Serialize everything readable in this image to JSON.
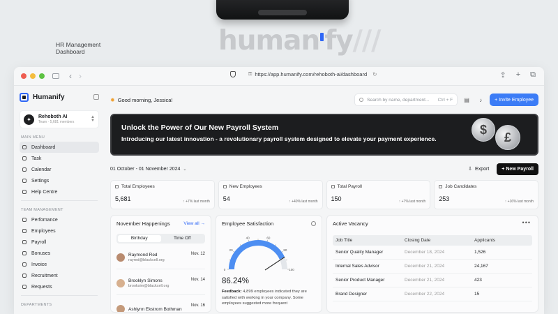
{
  "backdrop": {
    "caption": "HR Management Dashboard",
    "wordmark_left": "human",
    "wordmark_right": "fy",
    "wordmark_tail": "///"
  },
  "browser": {
    "url": "https://app.humanify.com/rehoboth-ai/dashboard",
    "back_glyph": "‹",
    "forward_glyph": "›"
  },
  "sidebar": {
    "brand": "Humanify",
    "org": {
      "name": "Rehoboth AI",
      "sub": "Team · 5,681 members",
      "initial": "✦"
    },
    "main_menu_label": "MAIN MENU",
    "main_items": [
      {
        "label": "Dashboard",
        "icon": "grid-icon",
        "active": true
      },
      {
        "label": "Task",
        "icon": "list-icon"
      },
      {
        "label": "Calendar",
        "icon": "calendar-icon"
      },
      {
        "label": "Settings",
        "icon": "gear-icon"
      },
      {
        "label": "Help Centre",
        "icon": "help-icon"
      }
    ],
    "team_label": "TEAM MANAGEMENT",
    "team_items": [
      {
        "label": "Perfomance",
        "icon": "chart-icon"
      },
      {
        "label": "Employees",
        "icon": "users-icon"
      },
      {
        "label": "Payroll",
        "icon": "wallet-icon"
      },
      {
        "label": "Bonuses",
        "icon": "gift-icon"
      },
      {
        "label": "Invoice",
        "icon": "file-icon"
      },
      {
        "label": "Recruitment",
        "icon": "briefcase-icon"
      },
      {
        "label": "Requests",
        "icon": "inbox-icon"
      }
    ],
    "dept_label": "DEPARTMENTS"
  },
  "header": {
    "greeting": "Good morning, Jessica!",
    "search_placeholder": "Search by name, department...",
    "search_shortcut": "Ctrl + F",
    "invite_label": "+ Invite Employee"
  },
  "banner": {
    "title": "Unlock the Power of Our New Payroll System",
    "subtitle": "Introducing our latest innovation - a revolutionary payroll system designed to elevate your payment experience.",
    "coin1": "$",
    "coin2": "£"
  },
  "filters": {
    "date_range": "01 October - 01 November 2024",
    "export_label": "Export",
    "new_payroll_label": "+ New Payroll"
  },
  "stats": [
    {
      "label": "Total Employees",
      "value": "5,681",
      "change": "↑ +7% last month"
    },
    {
      "label": "New Employees",
      "value": "54",
      "change": "↑ +40% last month"
    },
    {
      "label": "Total Payroll",
      "value": "150",
      "change": "↑ +7% last month"
    },
    {
      "label": "Job Candidates",
      "value": "253",
      "change": "↑ +16% last month"
    }
  ],
  "happenings": {
    "title": "November Happenings",
    "view_all": "View all →",
    "tabs": [
      "Birthday",
      "Time Off"
    ],
    "people": [
      {
        "name": "Raymond Red",
        "email": "rayred@blackcell.org",
        "date": "Nov. 12"
      },
      {
        "name": "Brooklyn Simons",
        "email": "brooksim@blackcell.org",
        "date": "Nov. 14"
      },
      {
        "name": "Ashlynn Ekstrom Bothman",
        "email": "",
        "date": "Nov. 16"
      }
    ]
  },
  "satisfaction": {
    "title": "Employee Satisfaction",
    "value_pct": 86.24,
    "value_label": "86.24%",
    "gauge_ticks": [
      "0",
      "10",
      "20",
      "30",
      "40",
      "50",
      "60",
      "70",
      "80",
      "90",
      "100"
    ],
    "feedback_lead": "Feedback:",
    "feedback": " 4,899 employees indicated they are satisfied with working in your company. Some employees suggested more frequent"
  },
  "vacancy": {
    "title": "Active Vacancy",
    "more": "•••",
    "columns": [
      "Job Title",
      "Closing Date",
      "Applicants"
    ],
    "rows": [
      [
        "Senior Quality Manager",
        "December 18, 2024",
        "1,526"
      ],
      [
        "Internal Sales Advisor",
        "December 21, 2024",
        "24,167"
      ],
      [
        "Senior Product Manager",
        "December 21, 2024",
        "423"
      ],
      [
        "Brand Designer",
        "December 22, 2024",
        "15"
      ]
    ]
  },
  "colors": {
    "accent": "#3b7cf6",
    "gauge": "#4d8ef2"
  }
}
